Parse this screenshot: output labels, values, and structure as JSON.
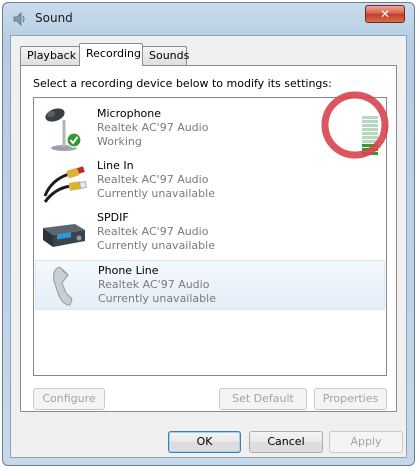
{
  "window": {
    "title": "Sound",
    "close_label": "✕"
  },
  "tabs": [
    {
      "label": "Playback",
      "active": false
    },
    {
      "label": "Recording",
      "active": true
    },
    {
      "label": "Sounds",
      "active": false
    }
  ],
  "instructions": "Select a recording device below to modify its settings:",
  "devices": [
    {
      "name": "Microphone",
      "driver": "Realtek AC'97 Audio",
      "status": "Working",
      "icon": "microphone-icon",
      "default": true
    },
    {
      "name": "Line In",
      "driver": "Realtek AC'97 Audio",
      "status": "Currently unavailable",
      "icon": "rca-cable-icon"
    },
    {
      "name": "SPDIF",
      "driver": "Realtek AC'97 Audio",
      "status": "Currently unavailable",
      "icon": "digital-device-icon"
    },
    {
      "name": "Phone Line",
      "driver": "Realtek AC'97 Audio",
      "status": "Currently unavailable",
      "icon": "phone-handset-icon",
      "selected": true
    }
  ],
  "level_meter": {
    "total_bars": 10,
    "lit_bars": 3,
    "lit_color": "#2e9e2e",
    "unlit_color": "#b8d8c2"
  },
  "buttons": {
    "configure": "Configure",
    "set_default": "Set Default",
    "properties": "Properties",
    "ok": "OK",
    "cancel": "Cancel",
    "apply": "Apply"
  },
  "colors": {
    "highlight_circle": "#d9434c"
  }
}
